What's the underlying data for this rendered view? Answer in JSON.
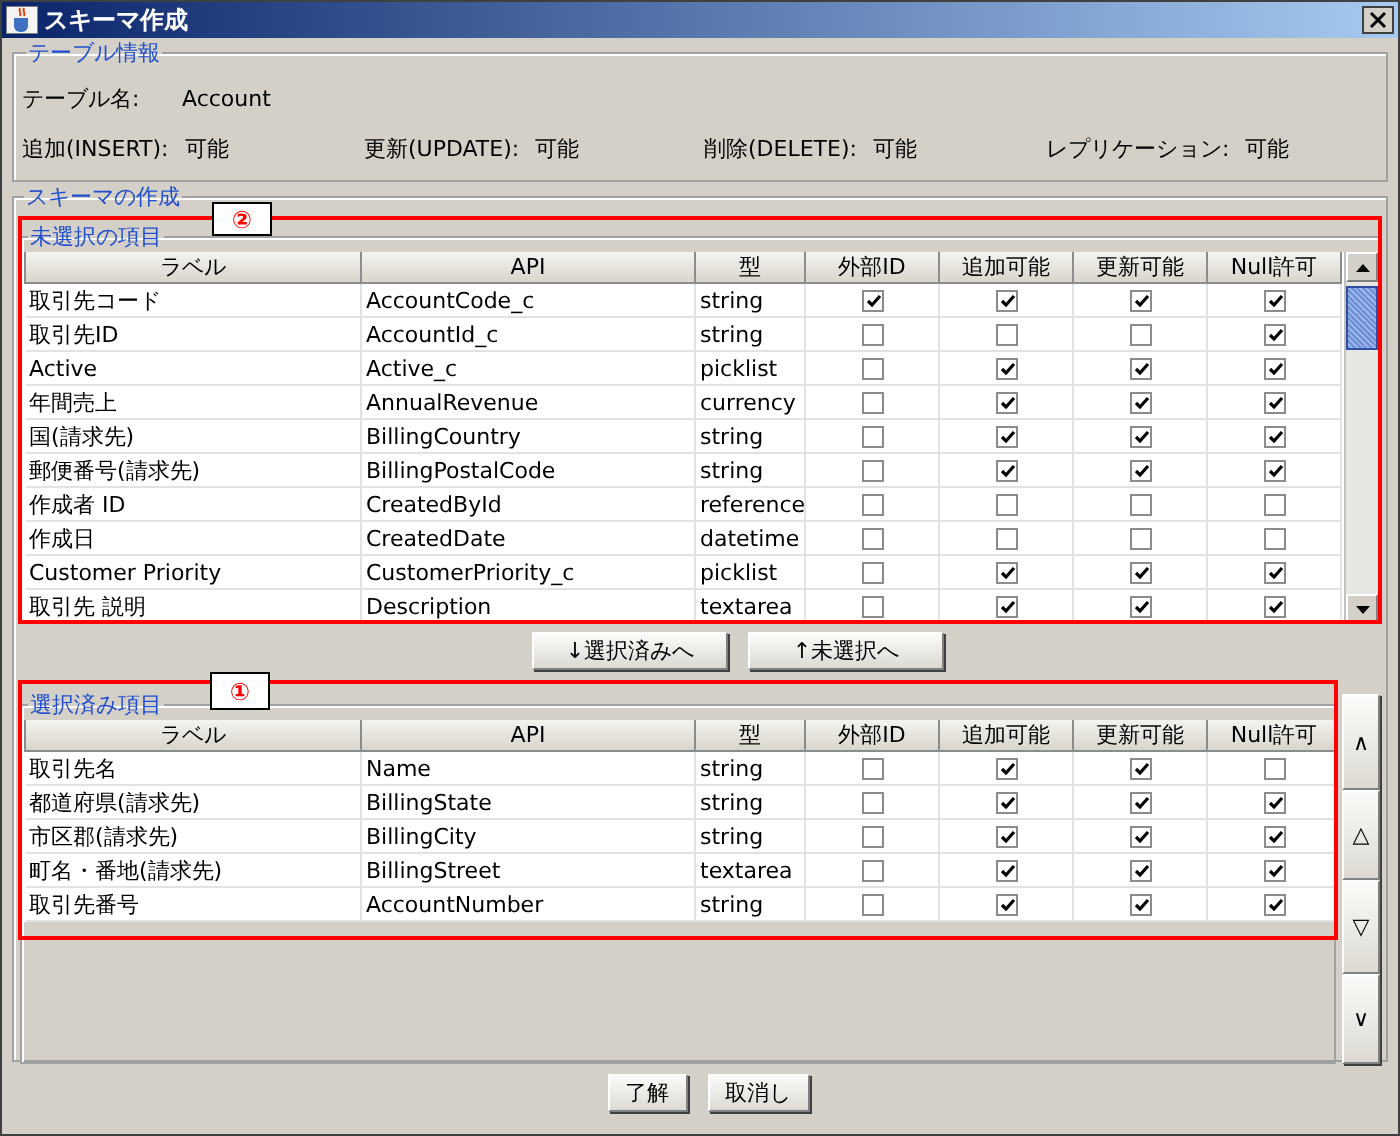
{
  "window": {
    "title": "スキーマ作成"
  },
  "table_info": {
    "title": "テーブル情報",
    "name_label": "テーブル名:",
    "name_value": "Account",
    "permissions": [
      {
        "label": "追加(INSERT):",
        "value": "可能"
      },
      {
        "label": "更新(UPDATE):",
        "value": "可能"
      },
      {
        "label": "削除(DELETE):",
        "value": "可能"
      },
      {
        "label": "レプリケーション:",
        "value": "可能"
      }
    ]
  },
  "schema": {
    "title": "スキーマの作成",
    "unselected": {
      "annotation": "②",
      "title": "未選択の項目",
      "columns": [
        "ラベル",
        "API",
        "型",
        "外部ID",
        "追加可能",
        "更新可能",
        "Null許可"
      ],
      "rows": [
        {
          "label": "取引先コード",
          "api": "AccountCode_c",
          "type": "string",
          "external_id": true,
          "createable": true,
          "updateable": true,
          "nillable": true
        },
        {
          "label": "取引先ID",
          "api": "AccountId_c",
          "type": "string",
          "external_id": false,
          "createable": false,
          "updateable": false,
          "nillable": true
        },
        {
          "label": "Active",
          "api": "Active_c",
          "type": "picklist",
          "external_id": false,
          "createable": true,
          "updateable": true,
          "nillable": true
        },
        {
          "label": "年間売上",
          "api": "AnnualRevenue",
          "type": "currency",
          "external_id": false,
          "createable": true,
          "updateable": true,
          "nillable": true
        },
        {
          "label": "国(請求先)",
          "api": "BillingCountry",
          "type": "string",
          "external_id": false,
          "createable": true,
          "updateable": true,
          "nillable": true
        },
        {
          "label": "郵便番号(請求先)",
          "api": "BillingPostalCode",
          "type": "string",
          "external_id": false,
          "createable": true,
          "updateable": true,
          "nillable": true
        },
        {
          "label": "作成者 ID",
          "api": "CreatedById",
          "type": "reference",
          "external_id": false,
          "createable": false,
          "updateable": false,
          "nillable": false
        },
        {
          "label": "作成日",
          "api": "CreatedDate",
          "type": "datetime",
          "external_id": false,
          "createable": false,
          "updateable": false,
          "nillable": false
        },
        {
          "label": "Customer Priority",
          "api": "CustomerPriority_c",
          "type": "picklist",
          "external_id": false,
          "createable": true,
          "updateable": true,
          "nillable": true
        },
        {
          "label": "取引先 説明",
          "api": "Description",
          "type": "textarea",
          "external_id": false,
          "createable": true,
          "updateable": true,
          "nillable": true
        }
      ]
    },
    "move_buttons": [
      "↓選択済みへ",
      "↑未選択へ"
    ],
    "selected": {
      "annotation": "①",
      "title": "選択済み項目",
      "columns": [
        "ラベル",
        "API",
        "型",
        "外部ID",
        "追加可能",
        "更新可能",
        "Null許可"
      ],
      "rows": [
        {
          "label": "取引先名",
          "api": "Name",
          "type": "string",
          "external_id": false,
          "createable": true,
          "updateable": true,
          "nillable": false
        },
        {
          "label": "都道府県(請求先)",
          "api": "BillingState",
          "type": "string",
          "external_id": false,
          "createable": true,
          "updateable": true,
          "nillable": true
        },
        {
          "label": "市区郡(請求先)",
          "api": "BillingCity",
          "type": "string",
          "external_id": false,
          "createable": true,
          "updateable": true,
          "nillable": true
        },
        {
          "label": "町名・番地(請求先)",
          "api": "BillingStreet",
          "type": "textarea",
          "external_id": false,
          "createable": true,
          "updateable": true,
          "nillable": true
        },
        {
          "label": "取引先番号",
          "api": "AccountNumber",
          "type": "string",
          "external_id": false,
          "createable": true,
          "updateable": true,
          "nillable": true
        }
      ]
    },
    "order_buttons": [
      "∧",
      "△",
      "▽",
      "∨"
    ]
  },
  "buttons": [
    "了解",
    "取消し"
  ]
}
